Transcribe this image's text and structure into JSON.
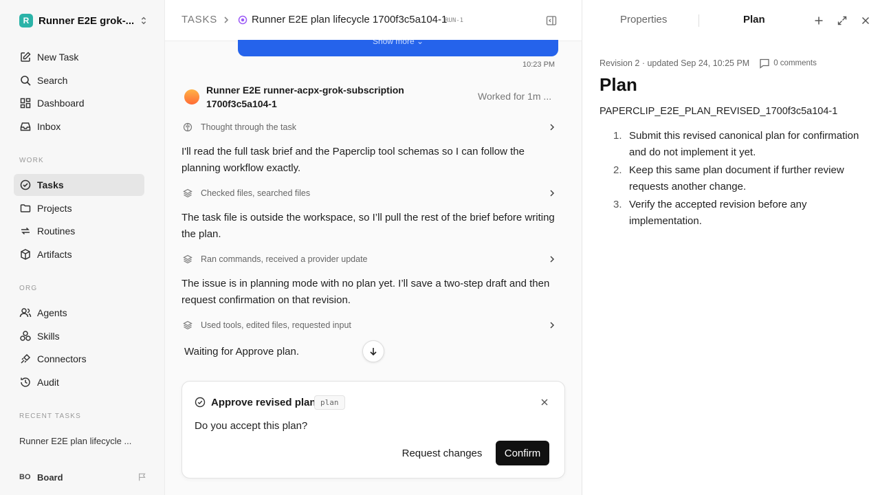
{
  "workspace": {
    "logo_letter": "R",
    "name": "Runner E2E grok-..."
  },
  "nav": {
    "new_task": "New Task",
    "search": "Search",
    "dashboard": "Dashboard",
    "inbox": "Inbox",
    "work_label": "WORK",
    "tasks": "Tasks",
    "projects": "Projects",
    "routines": "Routines",
    "artifacts": "Artifacts",
    "org_label": "ORG",
    "agents": "Agents",
    "skills": "Skills",
    "connectors": "Connectors",
    "audit": "Audit",
    "recent_label": "RECENT TASKS",
    "recent_task": "Runner E2E plan lifecycle ..."
  },
  "board": {
    "initials": "BO",
    "name": "Board"
  },
  "header": {
    "crumb_root": "TASKS",
    "task_title": "Runner E2E plan lifecycle 1700f3c5a104-1",
    "run_tag": "RUN-1"
  },
  "thread": {
    "show_more": "Show more",
    "timestamp": "10:23 PM",
    "agent_name": "Runner E2E runner-acpx-grok-subscription 1700f3c5a104-1",
    "worked": "Worked for 1m ...",
    "steps": [
      "Thought through the task",
      "Checked files, searched files",
      "Ran commands, received a provider update",
      "Used tools, edited files, requested input"
    ],
    "paragraphs": [
      "I'll read the full task brief and the Paperclip tool schemas so I can follow the planning workflow exactly.",
      "The task file is outside the workspace, so I’ll pull the rest of the brief before writing the plan.",
      "The issue is in planning mode with no plan yet. I’ll save a two-step draft and then request confirmation on that revision."
    ],
    "waiting": "Waiting for Approve plan."
  },
  "approval": {
    "title": "Approve revised plan",
    "tag": "plan",
    "question": "Do you accept this plan?",
    "request_changes": "Request changes",
    "confirm": "Confirm"
  },
  "panel": {
    "tab_properties": "Properties",
    "tab_plan": "Plan",
    "revision": "Revision 2 · updated Sep 24, 10:25 PM",
    "comments": "0 comments",
    "heading": "Plan",
    "plan_id": "PAPERCLIP_E2E_PLAN_REVISED_1700f3c5a104-1",
    "items": [
      {
        "num": "1.",
        "text": "Submit this revised canonical plan for confirmation and do not implement it yet."
      },
      {
        "num": "2.",
        "text": "Keep this same plan document if further review requests another change."
      },
      {
        "num": "3.",
        "text": "Verify the accepted revision before any implementation."
      }
    ]
  },
  "colors": {
    "accent_blue": "#2563eb",
    "status_purple": "#9b59f6",
    "confirm_bg": "#111111",
    "logo_teal": "#2bb3a8"
  }
}
